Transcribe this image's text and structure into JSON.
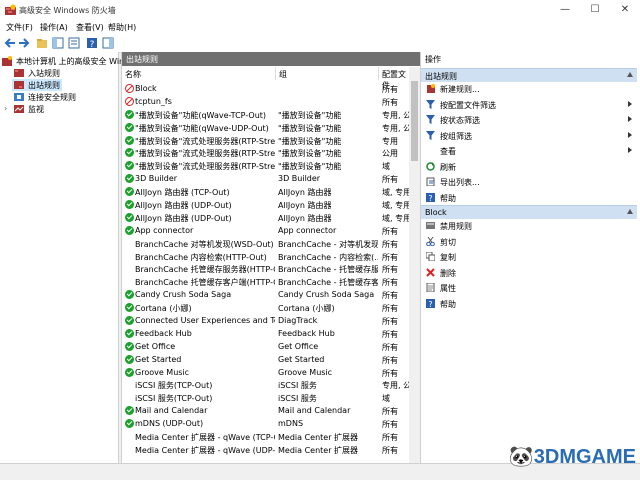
{
  "window": {
    "title": "高级安全 Windows 防火墙",
    "min": "—",
    "max": "☐",
    "close": "✕"
  },
  "menu": [
    "文件(F)",
    "操作(A)",
    "查看(V)",
    "帮助(H)"
  ],
  "tree": {
    "root": "本地计算机 上的高级安全 Wind",
    "items": [
      "入站规则",
      "出站规则",
      "连接安全规则",
      "监视"
    ],
    "selected": "出站规则"
  },
  "center": {
    "title": "出站规则",
    "columns": [
      "名称",
      "组",
      "配置文件"
    ],
    "rows": [
      {
        "status": "blocked",
        "name": "Block",
        "group": "",
        "profile": "所有"
      },
      {
        "status": "blocked",
        "name": "tcptun_fs",
        "group": "",
        "profile": "所有"
      },
      {
        "status": "allow",
        "name": "\"播放到设备\"功能(qWave-TCP-Out)",
        "group": "\"播放到设备\"功能",
        "profile": "专用, 公"
      },
      {
        "status": "allow",
        "name": "\"播放到设备\"功能(qWave-UDP-Out)",
        "group": "\"播放到设备\"功能",
        "profile": "专用, 公"
      },
      {
        "status": "allow",
        "name": "\"播放到设备\"流式处理服务器(RTP-Strea...",
        "group": "\"播放到设备\"功能",
        "profile": "专用"
      },
      {
        "status": "allow",
        "name": "\"播放到设备\"流式处理服务器(RTP-Strea...",
        "group": "\"播放到设备\"功能",
        "profile": "公用"
      },
      {
        "status": "allow",
        "name": "\"播放到设备\"流式处理服务器(RTP-Strea...",
        "group": "\"播放到设备\"功能",
        "profile": "域"
      },
      {
        "status": "allow",
        "name": "3D Builder",
        "group": "3D Builder",
        "profile": "所有"
      },
      {
        "status": "allow",
        "name": "AllJoyn 路由器 (TCP-Out)",
        "group": "AllJoyn 路由器",
        "profile": "域, 专用"
      },
      {
        "status": "allow",
        "name": "AllJoyn 路由器 (UDP-Out)",
        "group": "AllJoyn 路由器",
        "profile": "域, 专用"
      },
      {
        "status": "allow",
        "name": "AllJoyn 路由器 (UDP-Out)",
        "group": "AllJoyn 路由器",
        "profile": "域, 专用"
      },
      {
        "status": "allow",
        "name": "App connector",
        "group": "App connector",
        "profile": "所有"
      },
      {
        "status": "none",
        "name": "BranchCache 对等机发现(WSD-Out)",
        "group": "BranchCache - 对等机发现...",
        "profile": "所有"
      },
      {
        "status": "none",
        "name": "BranchCache 内容检索(HTTP-Out)",
        "group": "BranchCache - 内容检索(...",
        "profile": "所有"
      },
      {
        "status": "none",
        "name": "BranchCache 托管缓存服务器(HTTP-O...",
        "group": "BranchCache - 托管缓存服...",
        "profile": "所有"
      },
      {
        "status": "none",
        "name": "BranchCache 托管缓存客户端(HTTP-O...",
        "group": "BranchCache - 托管缓存客...",
        "profile": "所有"
      },
      {
        "status": "allow",
        "name": "Candy Crush Soda Saga",
        "group": "Candy Crush Soda Saga",
        "profile": "所有"
      },
      {
        "status": "allow",
        "name": "Cortana (小娜)",
        "group": "Cortana (小娜)",
        "profile": "所有"
      },
      {
        "status": "allow",
        "name": "Connected User Experiences and Tel...",
        "group": "DiagTrack",
        "profile": "所有"
      },
      {
        "status": "allow",
        "name": "Feedback Hub",
        "group": "Feedback Hub",
        "profile": "所有"
      },
      {
        "status": "allow",
        "name": "Get Office",
        "group": "Get Office",
        "profile": "所有"
      },
      {
        "status": "allow",
        "name": "Get Started",
        "group": "Get Started",
        "profile": "所有"
      },
      {
        "status": "allow",
        "name": "Groove Music",
        "group": "Groove Music",
        "profile": "所有"
      },
      {
        "status": "none",
        "name": "iSCSI 服务(TCP-Out)",
        "group": "iSCSI 服务",
        "profile": "专用, 公"
      },
      {
        "status": "none",
        "name": "iSCSI 服务(TCP-Out)",
        "group": "iSCSI 服务",
        "profile": "域"
      },
      {
        "status": "allow",
        "name": "Mail and Calendar",
        "group": "Mail and Calendar",
        "profile": "所有"
      },
      {
        "status": "allow",
        "name": "mDNS (UDP-Out)",
        "group": "mDNS",
        "profile": "所有"
      },
      {
        "status": "none",
        "name": "Media Center 扩展器 - qWave (TCP-O...",
        "group": "Media Center 扩展器",
        "profile": "所有"
      },
      {
        "status": "none",
        "name": "Media Center 扩展器 - qWave (UDP-...",
        "group": "Media Center 扩展器",
        "profile": "所有"
      }
    ]
  },
  "actions": {
    "title": "操作",
    "section1": "出站规则",
    "items1": [
      {
        "label": "新建规则...",
        "icon": "new-rule",
        "arrow": false
      },
      {
        "label": "按配置文件筛选",
        "icon": "filter",
        "arrow": true
      },
      {
        "label": "按状态筛选",
        "icon": "filter",
        "arrow": true
      },
      {
        "label": "按组筛选",
        "icon": "filter",
        "arrow": true
      },
      {
        "label": "查看",
        "icon": "none",
        "arrow": true
      },
      {
        "label": "刷新",
        "icon": "refresh",
        "arrow": false
      },
      {
        "label": "导出列表...",
        "icon": "export",
        "arrow": false
      },
      {
        "label": "帮助",
        "icon": "help",
        "arrow": false
      }
    ],
    "section2": "Block",
    "items2": [
      {
        "label": "禁用规则",
        "icon": "disable"
      },
      {
        "label": "剪切",
        "icon": "cut"
      },
      {
        "label": "复制",
        "icon": "copy"
      },
      {
        "label": "删除",
        "icon": "delete"
      },
      {
        "label": "属性",
        "icon": "properties"
      },
      {
        "label": "帮助",
        "icon": "help"
      }
    ]
  },
  "watermark": {
    "prefix": "🐼",
    "text": "3DMGAME"
  }
}
